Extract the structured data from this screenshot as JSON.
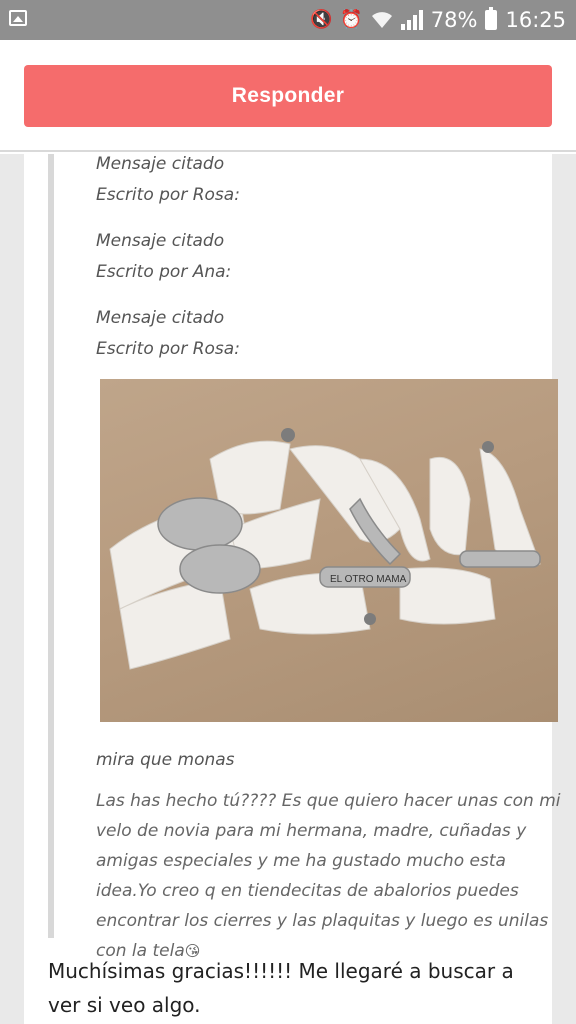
{
  "status_bar": {
    "battery": "78%",
    "time": "16:25",
    "icons": [
      "gallery-icon",
      "mute-icon",
      "alarm-icon",
      "wifi-icon",
      "signal-icon",
      "battery-icon"
    ]
  },
  "header": {
    "reply_label": "Responder",
    "accent_color": "#f56c6c"
  },
  "post": {
    "quotes": [
      {
        "title": "Mensaje citado",
        "author": "Escrito por Rosa:"
      },
      {
        "title": "Mensaje citado",
        "author": "Escrito por Ana:"
      },
      {
        "title": "Mensaje citado",
        "author": "Escrito por Rosa:"
      }
    ],
    "photo_plaque_text": "EL OTRO MAMA",
    "photo_caption": "mira que monas",
    "quoted_message": "Las has hecho tú???? Es que quiero hacer unas con mi velo de novia para mi hermana, madre, cuñadas y amigas especiales y me ha gustado mucho esta idea.Yo creo q en tiendecitas de abalorios puedes encontrar los cierres y las plaquitas y luego es unilas con la tela",
    "quoted_message_emoji": "😘",
    "reply": "Muchísimas gracias!!!!!! Me llegaré a buscar a ver si veo algo."
  }
}
